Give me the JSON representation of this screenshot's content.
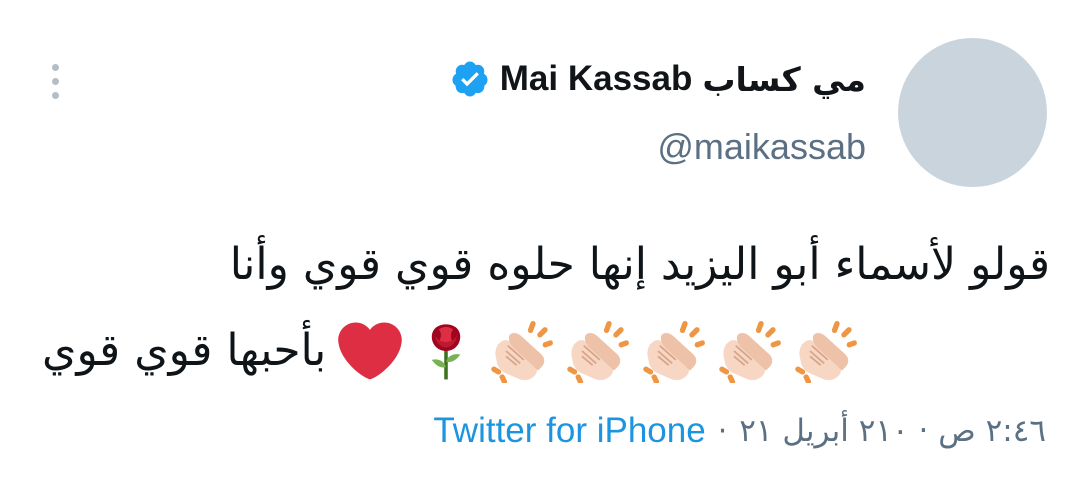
{
  "tweet": {
    "author": {
      "name_arabic": "مي كساب",
      "name_latin": "Mai Kassab",
      "handle": "@maikassab",
      "verified": true,
      "avatar_color": "#c9d4dc"
    },
    "text_line1": "قولو لأسماء أبو اليزيد إنها حلوه قوي قوي وأنا",
    "text_line2": "بأحبها قوي قوي",
    "emojis": [
      "red-heart",
      "rose",
      "clapping-hands",
      "clapping-hands",
      "clapping-hands",
      "clapping-hands",
      "clapping-hands"
    ],
    "timestamp": "٢:٤٦ ص · ٢١٠ أبريل ٢١",
    "separator": "·",
    "source": "Twitter for iPhone",
    "more_icon": "vertical-dots-icon"
  },
  "colors": {
    "verified_blue": "#1da1f2",
    "link_blue": "#1b95e0",
    "secondary_text": "#5b7083",
    "primary_text": "#0f1419"
  }
}
